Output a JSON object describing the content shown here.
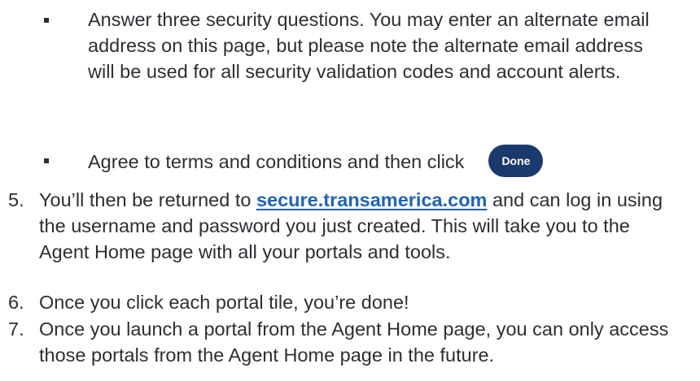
{
  "bullets": [
    {
      "text": "Answer three security questions. You may enter an alternate email address on this page, but please note the alternate email address will be used for all security validation codes and account alerts."
    },
    {
      "text": "Agree to terms and conditions and then click",
      "button_label": "Done"
    }
  ],
  "steps": [
    {
      "number": "5.",
      "text_before": "You’ll then be returned to ",
      "link_text": "secure.transamerica.com",
      "text_after": " and can log in using the username and password you just created. This will take you to the Agent Home page with all your portals and tools."
    },
    {
      "number": "6.",
      "text": "Once you click each portal tile, you’re done!"
    },
    {
      "number": "7.",
      "text": "Once you launch a portal from the Agent Home page, you can only access those portals from the Agent Home page in the future."
    }
  ],
  "colors": {
    "text": "#2b2f33",
    "link": "#1f63b6",
    "button_bg": "#1a3a6e",
    "button_text": "#ffffff"
  }
}
